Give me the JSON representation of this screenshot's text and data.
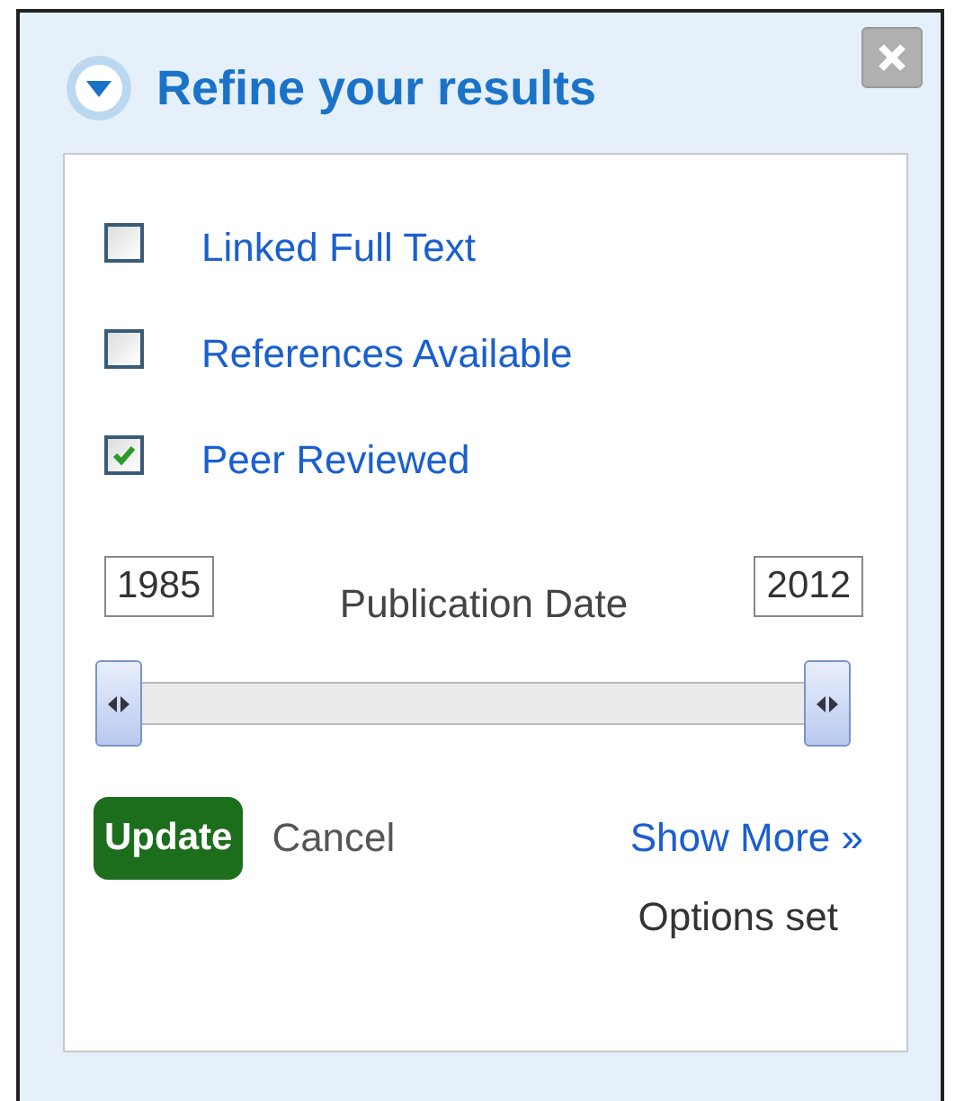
{
  "panel": {
    "title": "Refine your results",
    "expanded": true
  },
  "filters": [
    {
      "label": "Linked Full Text",
      "checked": false
    },
    {
      "label": "References Available",
      "checked": false
    },
    {
      "label": "Peer Reviewed",
      "checked": true
    }
  ],
  "date_range": {
    "from": "1985",
    "label": "Publication Date",
    "to": "2012",
    "slider": {
      "start": {
        "level": 0
      },
      "end": {
        "level": 1
      }
    }
  },
  "actions": {
    "update": "Update",
    "cancel": "Cancel",
    "show_more": "Show More »",
    "note": "Options set"
  }
}
